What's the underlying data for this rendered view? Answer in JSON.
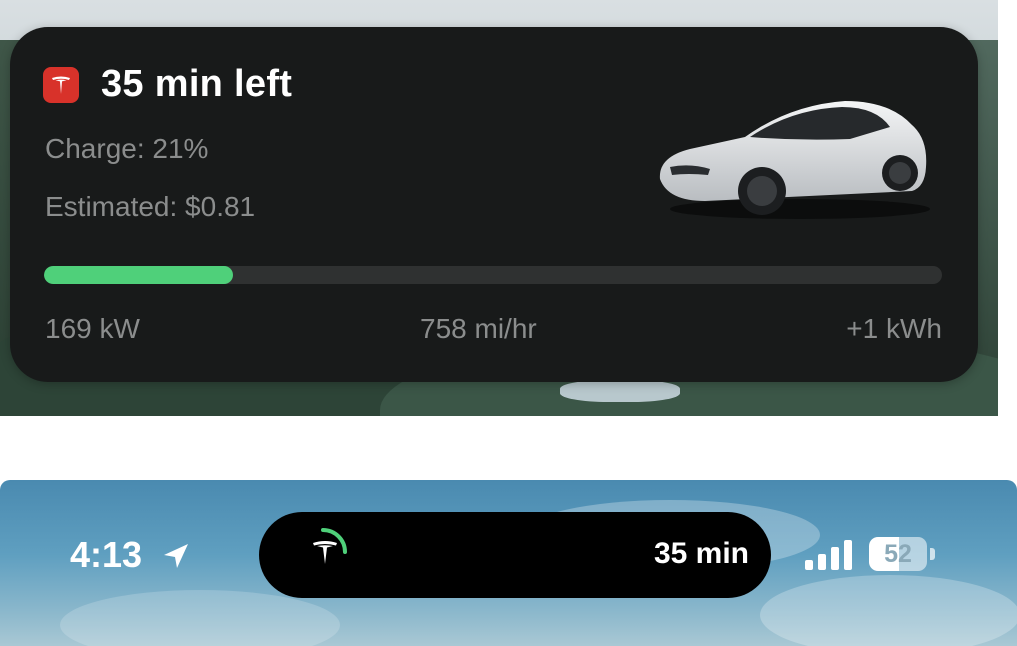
{
  "live_activity": {
    "title": "35 min left",
    "charge_text": "Charge: 21%",
    "estimate_text": "Estimated: $0.81",
    "charge_progress_fraction": 0.21,
    "progress_color": "#4fd07a",
    "app_icon_color": "#d8322a",
    "app_icon": "tesla-logo-icon",
    "car_image": "white-sedan",
    "stats": {
      "power": "169 kW",
      "rate": "758 mi/hr",
      "energy": "+1 kWh"
    }
  },
  "status_bar": {
    "time": "4:13",
    "location_icon": "location-arrow-icon",
    "dynamic_island": {
      "logo": "tesla-logo-icon",
      "ring_color": "#4fd07a",
      "time_remaining": "35 min"
    },
    "signal_icon": "cellular-signal-icon",
    "battery_percent": "52",
    "battery_level_fraction": 0.52
  }
}
